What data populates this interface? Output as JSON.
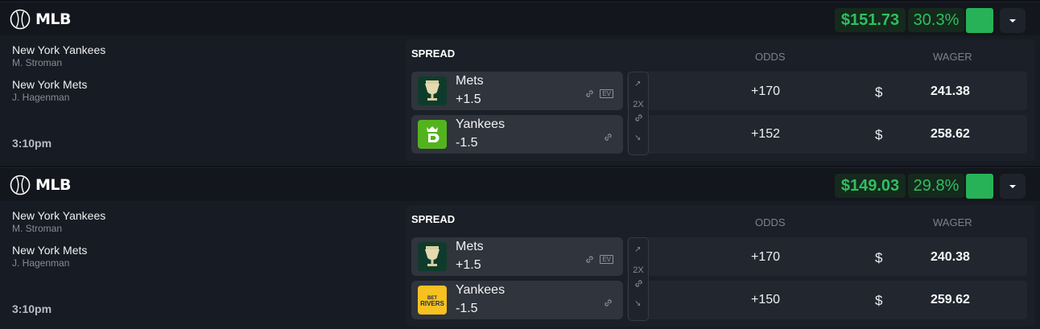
{
  "games": [
    {
      "sport": "MLB",
      "profit": "$151.73",
      "percent": "30.3%",
      "team1": {
        "name": "New York Yankees",
        "pitcher": "M. Stroman"
      },
      "team2": {
        "name": "New York Mets",
        "pitcher": "J. Hagenman"
      },
      "time": "3:10pm",
      "market_label": "SPREAD",
      "odds_header": "ODDS",
      "wager_header": "WAGER",
      "middle_label": "2X",
      "bets": [
        {
          "book": "trophy-book",
          "team": "Mets",
          "line": "+1.5",
          "odds": "+170",
          "currency": "$",
          "wager": "241.38",
          "ev_label": "EV"
        },
        {
          "book": "draftkings",
          "team": "Yankees",
          "line": "-1.5",
          "odds": "+152",
          "currency": "$",
          "wager": "258.62"
        }
      ]
    },
    {
      "sport": "MLB",
      "profit": "$149.03",
      "percent": "29.8%",
      "team1": {
        "name": "New York Yankees",
        "pitcher": "M. Stroman"
      },
      "team2": {
        "name": "New York Mets",
        "pitcher": "J. Hagenman"
      },
      "time": "3:10pm",
      "market_label": "SPREAD",
      "odds_header": "ODDS",
      "wager_header": "WAGER",
      "middle_label": "2X",
      "bets": [
        {
          "book": "trophy-book",
          "team": "Mets",
          "line": "+1.5",
          "odds": "+170",
          "currency": "$",
          "wager": "240.38",
          "ev_label": "EV"
        },
        {
          "book": "betrivers",
          "team": "Yankees",
          "line": "-1.5",
          "odds": "+150",
          "currency": "$",
          "wager": "259.62"
        }
      ]
    }
  ],
  "icons": {
    "sport": "baseball-icon",
    "link": "link-icon",
    "ev": "ev-badge",
    "dropdown": "caret-down-icon"
  },
  "colors": {
    "profit_text": "#2fbf5f",
    "profit_bg": "#15291d",
    "action_green": "#27b257",
    "card_bg": "#171b23",
    "header_bg": "#13161c"
  }
}
